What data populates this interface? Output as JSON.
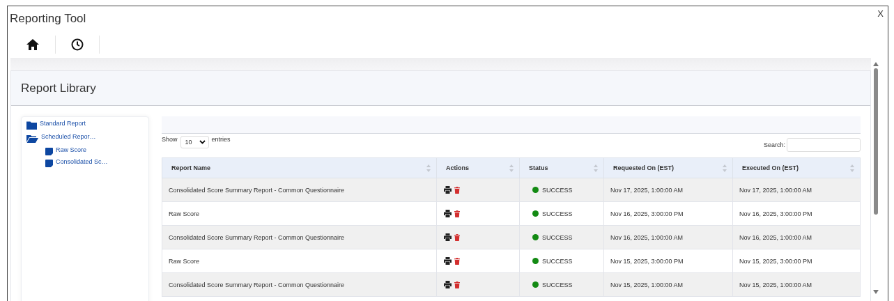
{
  "window": {
    "title": "Reporting Tool",
    "close": "X"
  },
  "panel": {
    "title": "Report Library"
  },
  "tree": [
    {
      "label": "Standard Report",
      "expanded": false
    },
    {
      "label": "Scheduled Repor…",
      "expanded": true,
      "children": [
        {
          "label": "Raw Score"
        },
        {
          "label": "Consolidated Sc…"
        }
      ]
    }
  ],
  "length": {
    "before": "Show",
    "value": "10",
    "after": "entries"
  },
  "search": {
    "label": "Search:"
  },
  "table": {
    "columns": [
      "Report Name",
      "Actions",
      "Status",
      "Requested On (EST)",
      "Executed On (EST)"
    ],
    "rows": [
      {
        "name": "Consolidated Score Summary Report - Common Questionnaire",
        "status": "SUCCESS",
        "requested": "Nov 17, 2025, 1:00:00 AM",
        "executed": "Nov 17, 2025, 1:00:00 AM"
      },
      {
        "name": "Raw Score",
        "status": "SUCCESS",
        "requested": "Nov 16, 2025, 3:00:00 PM",
        "executed": "Nov 16, 2025, 3:00:00 PM"
      },
      {
        "name": "Consolidated Score Summary Report - Common Questionnaire",
        "status": "SUCCESS",
        "requested": "Nov 16, 2025, 1:00:00 AM",
        "executed": "Nov 16, 2025, 1:00:00 AM"
      },
      {
        "name": "Raw Score",
        "status": "SUCCESS",
        "requested": "Nov 15, 2025, 3:00:00 PM",
        "executed": "Nov 15, 2025, 3:00:00 PM"
      },
      {
        "name": "Consolidated Score Summary Report - Common Questionnaire",
        "status": "SUCCESS",
        "requested": "Nov 15, 2025, 1:00:00 AM",
        "executed": "Nov 15, 2025, 1:00:00 AM"
      }
    ]
  }
}
